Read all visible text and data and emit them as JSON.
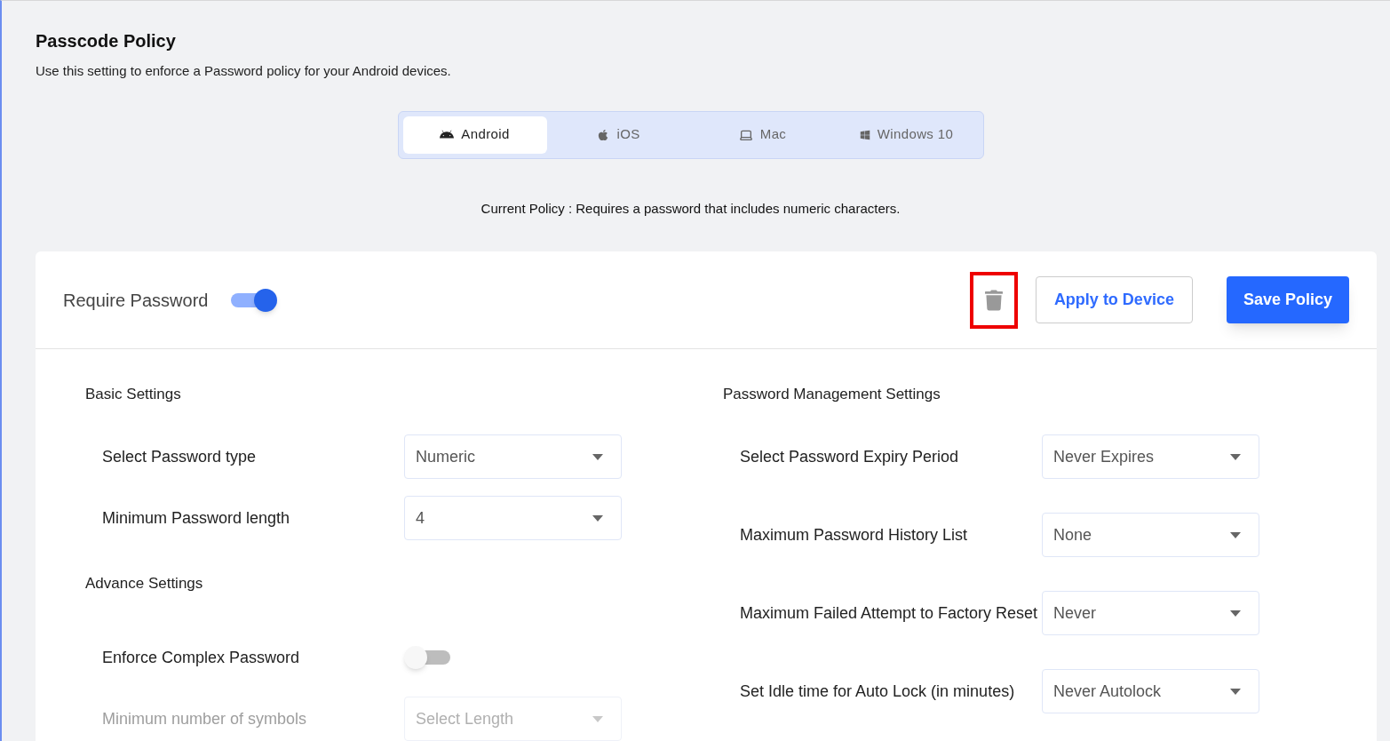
{
  "page": {
    "title": "Passcode Policy",
    "description": "Use this setting to enforce a Password policy for your Android devices."
  },
  "platform_tabs": [
    {
      "label": "Android",
      "selected": true
    },
    {
      "label": "iOS",
      "selected": false
    },
    {
      "label": "Mac",
      "selected": false
    },
    {
      "label": "Windows 10",
      "selected": false
    }
  ],
  "current_policy": "Current Policy : Requires a password that includes numeric characters.",
  "header": {
    "label": "Require Password",
    "on": true,
    "delete_highlighted": true,
    "apply_button": "Apply to Device",
    "save_button": "Save Policy"
  },
  "left_sections": [
    {
      "heading": "Basic Settings",
      "rows": [
        {
          "kind": "select",
          "label": "Select Password type",
          "value": "Numeric",
          "disabled": false
        },
        {
          "kind": "select",
          "label": "Minimum Password length",
          "value": "4",
          "disabled": false
        }
      ]
    },
    {
      "heading": "Advance Settings",
      "rows": [
        {
          "kind": "toggle",
          "label": "Enforce Complex Password",
          "on": false,
          "disabled": false
        },
        {
          "kind": "select",
          "label": "Minimum number of symbols",
          "placeholder": "Select Length",
          "disabled": true
        }
      ]
    }
  ],
  "right_section": {
    "heading": "Password Management Settings",
    "rows": [
      {
        "kind": "select",
        "label": "Select Password Expiry Period",
        "value": "Never Expires",
        "disabled": false
      },
      {
        "kind": "select",
        "label": "Maximum Password History List",
        "value": "None",
        "disabled": false
      },
      {
        "kind": "select",
        "label": "Maximum Failed Attempt to Factory Reset",
        "value": "Never",
        "disabled": false
      },
      {
        "kind": "select",
        "label": "Set Idle time for Auto Lock (in minutes)",
        "value": "Never Autolock",
        "disabled": false
      }
    ]
  }
}
